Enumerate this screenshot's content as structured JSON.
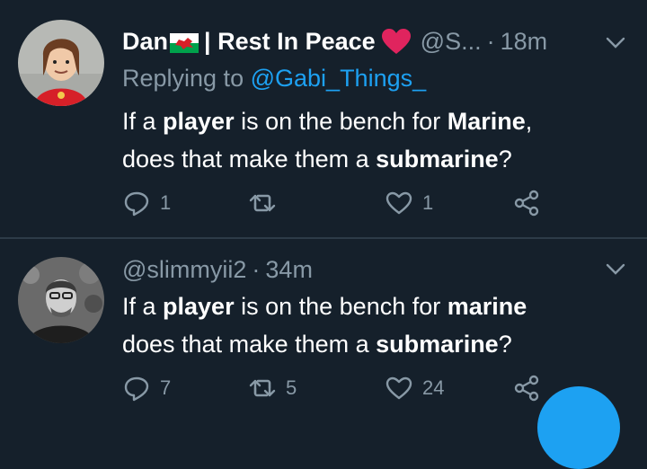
{
  "colors": {
    "background": "#15202b",
    "text": "#ffffff",
    "muted": "#8899a6",
    "link": "#1da1f2",
    "heart": "#e0245e"
  },
  "tweets": [
    {
      "display_name": "Dan",
      "name_suffix": "| Rest In Peace",
      "handle": "@S...",
      "time": "18m",
      "reply_prefix": "Replying to",
      "reply_to": "@Gabi_Things_",
      "text_parts": [
        "If a ",
        "player",
        " is on the bench for ",
        "Marine",
        ",",
        "does that make them a ",
        "submarine",
        "?"
      ],
      "counts": {
        "reply": "1",
        "retweet": "",
        "like": "1"
      }
    },
    {
      "handle": "@slimmyii2",
      "time": "34m",
      "text_parts": [
        "If a ",
        "player",
        " is on the bench for ",
        "marine",
        "does that make them a ",
        "submarine",
        "?"
      ],
      "counts": {
        "reply": "7",
        "retweet": "5",
        "like": "24"
      }
    }
  ],
  "icons": [
    "reply-icon",
    "retweet-icon",
    "like-icon",
    "share-icon",
    "chevron-down-icon",
    "wales-flag-icon",
    "heart-emoji-icon"
  ]
}
